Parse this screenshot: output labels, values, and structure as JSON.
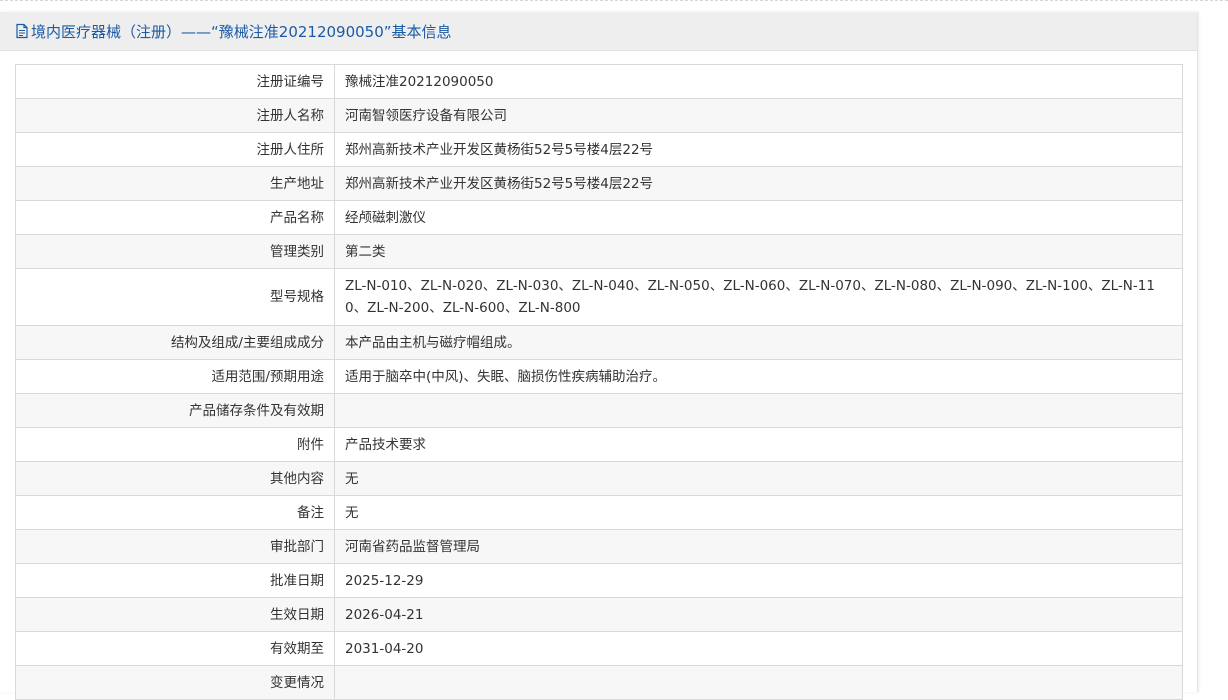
{
  "header": {
    "icon": "document-icon",
    "title": "境内医疗器械（注册）——“豫械注准20212090050”基本信息"
  },
  "rows": [
    {
      "label": "注册证编号",
      "value": "豫械注准20212090050"
    },
    {
      "label": "注册人名称",
      "value": "河南智领医疗设备有限公司"
    },
    {
      "label": "注册人住所",
      "value": "郑州高新技术产业开发区黄杨街52号5号楼4层22号"
    },
    {
      "label": "生产地址",
      "value": "郑州高新技术产业开发区黄杨街52号5号楼4层22号"
    },
    {
      "label": "产品名称",
      "value": "经颅磁刺激仪"
    },
    {
      "label": "管理类别",
      "value": "第二类"
    },
    {
      "label": "型号规格",
      "value": "ZL-N-010、ZL-N-020、ZL-N-030、ZL-N-040、ZL-N-050、ZL-N-060、ZL-N-070、ZL-N-080、ZL-N-090、ZL-N-100、ZL-N-110、ZL-N-200、ZL-N-600、ZL-N-800"
    },
    {
      "label": "结构及组成/主要组成成分",
      "value": "本产品由主机与磁疗帽组成。"
    },
    {
      "label": "适用范围/预期用途",
      "value": "适用于脑卒中(中风)、失眠、脑损伤性疾病辅助治疗。"
    },
    {
      "label": "产品储存条件及有效期",
      "value": ""
    },
    {
      "label": "附件",
      "value": "产品技术要求"
    },
    {
      "label": "其他内容",
      "value": "无"
    },
    {
      "label": "备注",
      "value": "无"
    },
    {
      "label": "审批部门",
      "value": "河南省药品监督管理局"
    },
    {
      "label": "批准日期",
      "value": "2025-12-29"
    },
    {
      "label": "生效日期",
      "value": "2026-04-21"
    },
    {
      "label": "有效期至",
      "value": "2031-04-20"
    },
    {
      "label": "变更情况",
      "value": ""
    }
  ]
}
